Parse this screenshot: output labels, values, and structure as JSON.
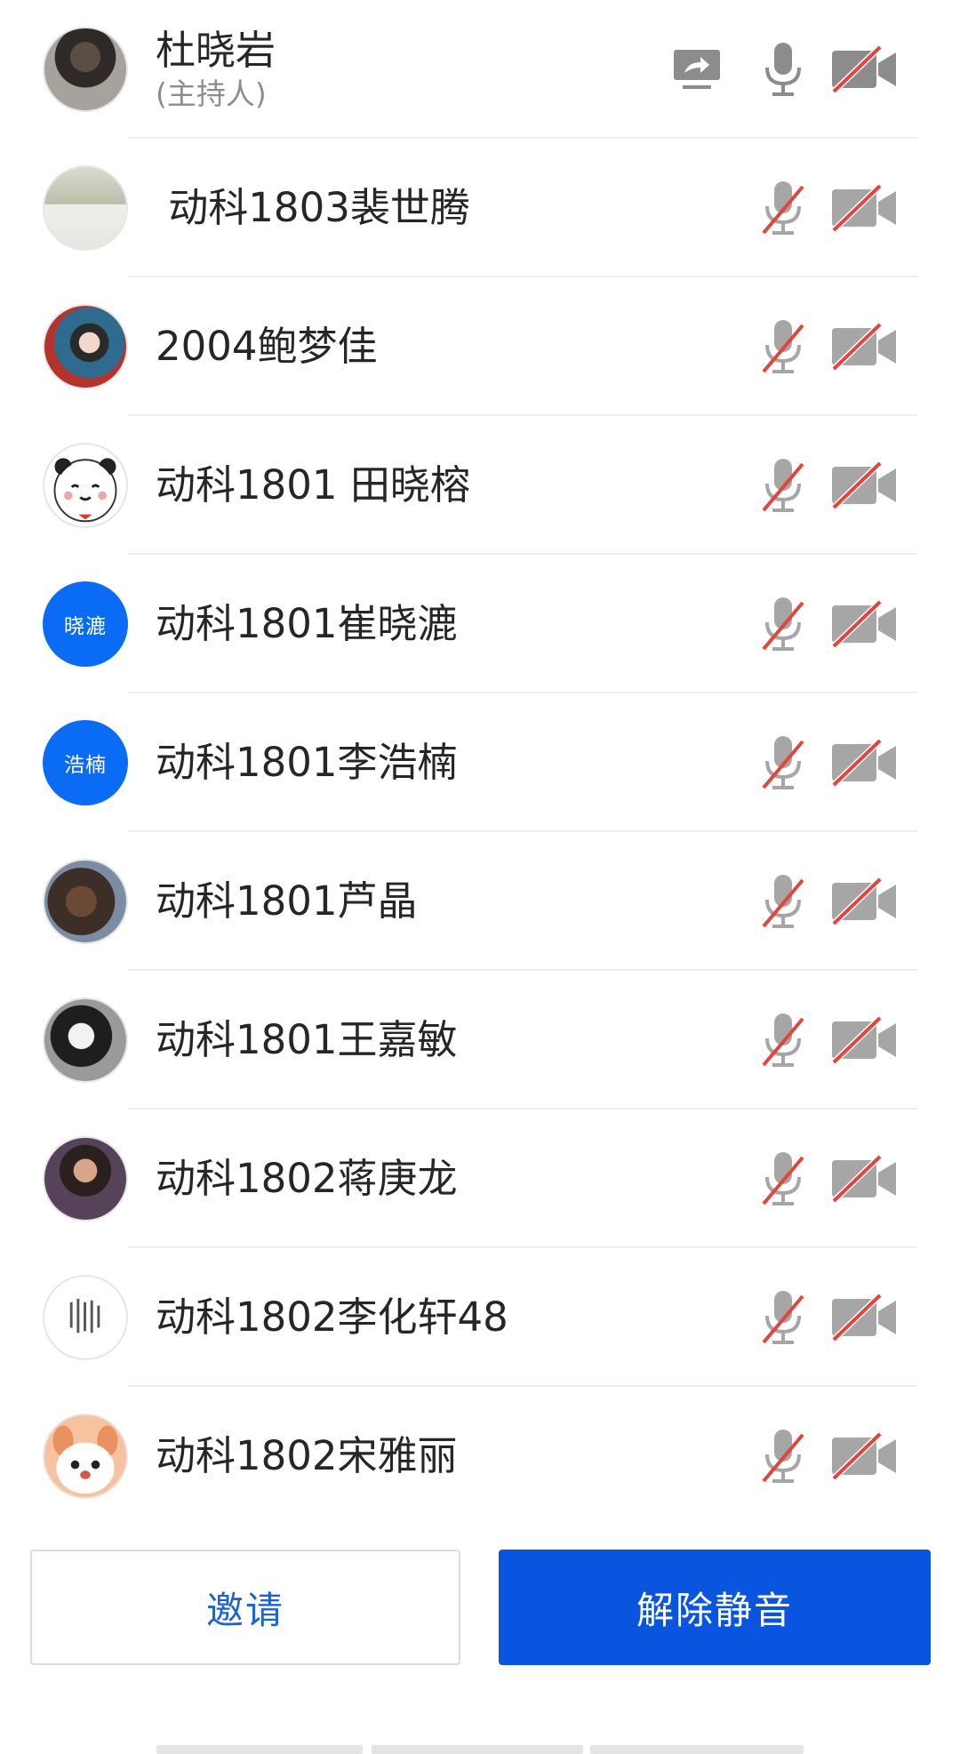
{
  "participants": [
    {
      "name": "杜晓岩",
      "role": "(主持人)",
      "avatar_text": "",
      "avatar_style": "photo-a",
      "mic": "on",
      "camera": "off",
      "sharing": true
    },
    {
      "name": " 动科1803裴世腾",
      "role": "",
      "avatar_text": "",
      "avatar_style": "photo-b",
      "mic": "muted",
      "camera": "off",
      "sharing": false
    },
    {
      "name": "2004鲍梦佳",
      "role": "",
      "avatar_text": "",
      "avatar_style": "photo-c",
      "mic": "muted",
      "camera": "off",
      "sharing": false
    },
    {
      "name": "动科1801 田晓榕",
      "role": "",
      "avatar_text": "",
      "avatar_style": "photo-d",
      "mic": "muted",
      "camera": "off",
      "sharing": false
    },
    {
      "name": "动科1801崔晓漉",
      "role": "",
      "avatar_text": "晓漉",
      "avatar_style": "text-avatar",
      "mic": "muted",
      "camera": "off",
      "sharing": false
    },
    {
      "name": "动科1801李浩楠",
      "role": "",
      "avatar_text": "浩楠",
      "avatar_style": "text-avatar",
      "mic": "muted",
      "camera": "off",
      "sharing": false
    },
    {
      "name": "动科1801芦晶",
      "role": "",
      "avatar_text": "",
      "avatar_style": "photo-e",
      "mic": "muted",
      "camera": "off",
      "sharing": false
    },
    {
      "name": "动科1801王嘉敏",
      "role": "",
      "avatar_text": "",
      "avatar_style": "photo-f",
      "mic": "muted",
      "camera": "off",
      "sharing": false
    },
    {
      "name": "动科1802蒋庚龙",
      "role": "",
      "avatar_text": "",
      "avatar_style": "photo-g",
      "mic": "muted",
      "camera": "off",
      "sharing": false
    },
    {
      "name": "动科1802李化轩48",
      "role": "",
      "avatar_text": "",
      "avatar_style": "photo-h",
      "mic": "muted",
      "camera": "off",
      "sharing": false
    },
    {
      "name": "动科1802宋雅丽",
      "role": "",
      "avatar_text": "",
      "avatar_style": "photo-i",
      "mic": "muted",
      "camera": "off",
      "sharing": false
    }
  ],
  "actions": {
    "invite_label": "邀请",
    "unmute_label": "解除静音"
  },
  "colors": {
    "accent": "#0a55e0",
    "text_avatar_bg": "#0a6cf5",
    "muted_slash": "#e0463c",
    "icon_gray": "#8c8c8c"
  },
  "icons": {
    "share": "screen-share-icon",
    "mic_on": "microphone-icon",
    "mic_muted": "microphone-muted-icon",
    "camera_off": "camera-off-icon"
  }
}
